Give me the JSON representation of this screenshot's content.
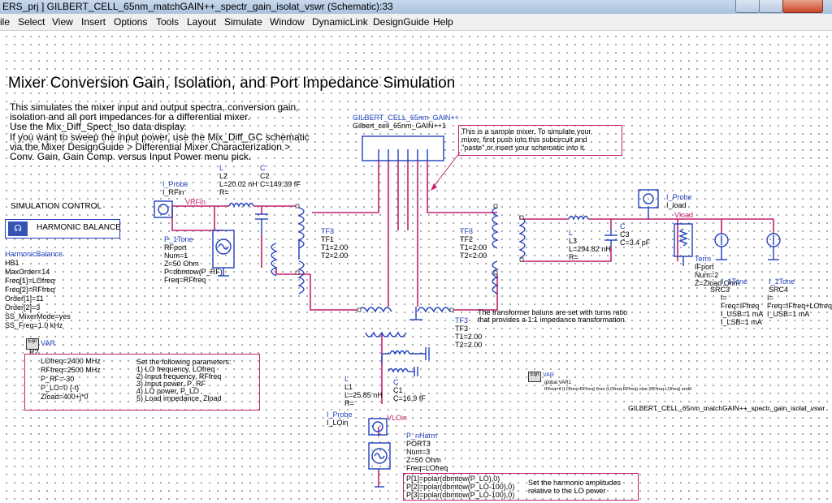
{
  "window": {
    "title": "ERS_prj ] GILBERT_CELL_65nm_matchGAIN++_spectr_gain_isolat_vswr (Schematic):33"
  },
  "menu": [
    "ile",
    "Select",
    "View",
    "Insert",
    "Options",
    "Tools",
    "Layout",
    "Simulate",
    "Window",
    "DynamicLink",
    "DesignGuide",
    "Help"
  ],
  "heading": "Mixer Conversion Gain, Isolation, and Port Impedance Simulation",
  "description": [
    "This simulates the mixer input and output spectra, conversion gain,",
    "isolation and all port impedances for a differential mixer.",
    "Use the Mix_Diff_Spect_Iso data display.",
    "If you want to sweep the input power, use the Mix_Diff_GC schematic",
    "via the Mixer DesignGuide > Differential Mixer Characterization >",
    "Conv. Gain, Gain Comp. versus Input Power menu pick."
  ],
  "sim_control": {
    "title": "SIMULATION CONTROL",
    "button": "HARMONIC BALANCE"
  },
  "hb": [
    "HarmonicBalance",
    "HB1",
    "MaxOrder=14",
    "Freq[1]=LOfreq",
    "Freq[2]=RFfreq",
    "Order[1]=11",
    "Order[2]=3",
    "SS_MixerMode=yes",
    "SS_Freq=1.0 kHz"
  ],
  "var_block": {
    "head": [
      "VAR",
      "R2"
    ],
    "values": [
      "LOfreq=2400 MHz",
      "RFfreq=2500 MHz",
      "P_RF=-30",
      "P_LO=0 {-t}",
      "Zload=400+j*0"
    ],
    "note": [
      "Set the following parameters:",
      "1)  LO frequency, LOfreq",
      "2)  Input frequency, RFfreq",
      "3)  Input power, P_RF",
      "4)  LO power, P_LO",
      "5)  Load impedance, Zload"
    ]
  },
  "var2": {
    "head": [
      "VAR",
      "global VAR1"
    ],
    "expr": "IFfreq=if (LOfreq>RFfreq) then (LOfreq-RFfreq) else (RFfreq-LOfreq) endif"
  },
  "subckt": {
    "name": "GILBERT_CELL_65nm_GAIN++",
    "inst": "Gilbert_cell_65nm_GAIN++1"
  },
  "sample_note": [
    "This is a sample mixer.  To simulate your",
    "mixer, first push into this subcircuit and",
    "\"paste\" or insert your schematic into it."
  ],
  "probe_rf": [
    "I_Probe",
    "I_RFin"
  ],
  "node_rf": "VRFin",
  "l2": [
    "L",
    "L2",
    "L=20.02 nH",
    "R="
  ],
  "c2": [
    "C",
    "C2",
    "C=149.39 fF"
  ],
  "port_rf": [
    "P_1Tone",
    "RFport",
    "Num=1",
    "Z=50 Ohm",
    "P=dbmtow(P_RF)",
    "Freq=RFfreq"
  ],
  "tf3a": [
    "TF3",
    "TF1",
    "T1=2.00",
    "T2=2.00"
  ],
  "tf3b": [
    "TF3",
    "TF2",
    "T1=2.00",
    "T2=2.00"
  ],
  "tf3c": [
    "TF3",
    "TF3",
    "T1=2.00",
    "T2=2.00"
  ],
  "tf_note": [
    "The transformer baluns are set with turns ratio",
    "that provides a 1:1 impedance transformation."
  ],
  "l3": [
    "L",
    "L3",
    "L=294.82 nH",
    "R="
  ],
  "c3": [
    "C",
    "C3",
    "C=3.4 pF"
  ],
  "probe_load": [
    "I_Probe",
    "I_load"
  ],
  "node_load": "Vload",
  "term": [
    "Term",
    "IFport",
    "Num=2",
    "Z=Zload Ohm"
  ],
  "src3": [
    "I_1Tone",
    "SRC3",
    "I=",
    "Freq=IFfreq",
    "I_USB=1 mA",
    "I_LSB=1 mA"
  ],
  "src4": [
    "I_1Tone",
    "SRC4",
    "I=",
    "Freq=IFfreq+LOfreq",
    "I_USB=1 mA"
  ],
  "l1": [
    "L",
    "L1",
    "L=25.85 nH",
    "R="
  ],
  "c1": [
    "C",
    "C1",
    "C=16.9 fF"
  ],
  "probe_lo": [
    "I_Probe",
    "I_LOin"
  ],
  "node_lo": "VLOin",
  "port_lo": [
    "P_nHarm",
    "PORT3",
    "Num=3",
    "Z=50 Ohm",
    "Freq=LOfreq"
  ],
  "port_lo_p": [
    "P[1]=polar(dbmtow(P_LO),0)",
    "P[2]=polar(dbmtow(P_LO-100),0)",
    "P[3]=polar(dbmtow(P_LO-100),0)"
  ],
  "harm_note": [
    "Set the harmonic amplitudes",
    "relative to the LO power"
  ],
  "schematic_name": "GILBERT_CELL_65nm_matchGAIN++_spectr_gain_isolat_vswr",
  "colors": {
    "wire": "#c21f6e",
    "component": "#1f3fbf",
    "text": "#000000"
  }
}
